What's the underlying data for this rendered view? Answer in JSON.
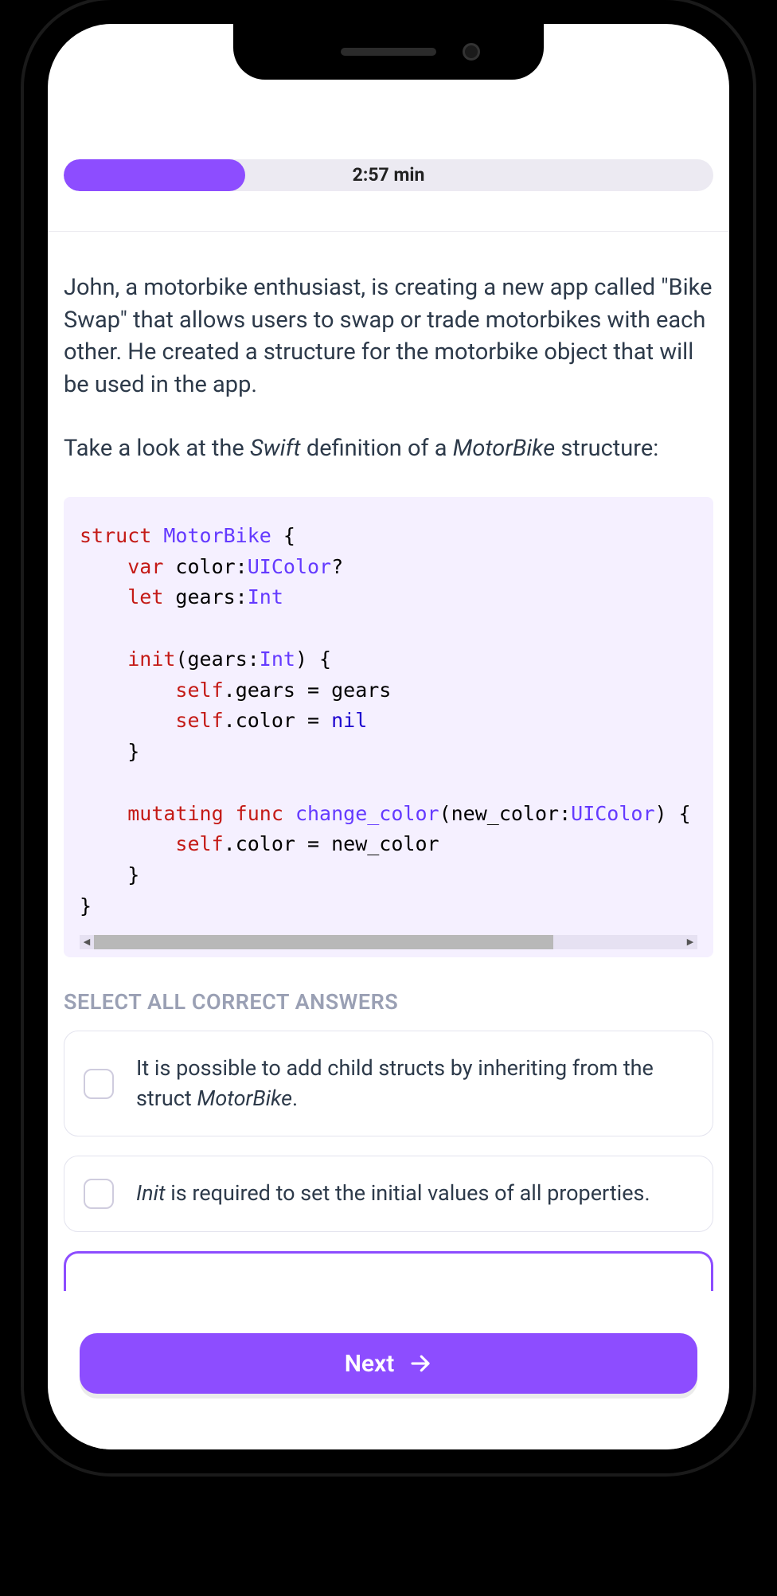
{
  "progress": {
    "percent": 28,
    "time_label": "2:57 min"
  },
  "question": {
    "para1_pre": "John, a motorbike enthusiast, is creating a new app called \"Bike Swap\" that allows users to swap or trade motorbikes with each other. He created a structure for the motorbike object that will be used in the app.",
    "para2_pre": "Take a look at the ",
    "para2_em1": "Swift",
    "para2_mid": " definition of a ",
    "para2_em2": "MotorBike",
    "para2_post": " structure:"
  },
  "code": {
    "lines": [
      [
        {
          "t": "struct ",
          "c": "kw"
        },
        {
          "t": "MotorBike",
          "c": "type"
        },
        {
          "t": " {",
          "c": "plain"
        }
      ],
      [
        {
          "t": "    ",
          "c": "plain"
        },
        {
          "t": "var",
          "c": "kw"
        },
        {
          "t": " color:",
          "c": "plain"
        },
        {
          "t": "UIColor",
          "c": "type"
        },
        {
          "t": "?",
          "c": "plain"
        }
      ],
      [
        {
          "t": "    ",
          "c": "plain"
        },
        {
          "t": "let",
          "c": "kw"
        },
        {
          "t": " gears:",
          "c": "plain"
        },
        {
          "t": "Int",
          "c": "type"
        }
      ],
      [
        {
          "t": "",
          "c": "plain"
        }
      ],
      [
        {
          "t": "    ",
          "c": "plain"
        },
        {
          "t": "init",
          "c": "kw"
        },
        {
          "t": "(gears:",
          "c": "plain"
        },
        {
          "t": "Int",
          "c": "type"
        },
        {
          "t": ") {",
          "c": "plain"
        }
      ],
      [
        {
          "t": "        ",
          "c": "plain"
        },
        {
          "t": "self",
          "c": "kw"
        },
        {
          "t": ".gears = gears",
          "c": "plain"
        }
      ],
      [
        {
          "t": "        ",
          "c": "plain"
        },
        {
          "t": "self",
          "c": "kw"
        },
        {
          "t": ".color = ",
          "c": "plain"
        },
        {
          "t": "nil",
          "c": "int"
        }
      ],
      [
        {
          "t": "    }",
          "c": "plain"
        }
      ],
      [
        {
          "t": "",
          "c": "plain"
        }
      ],
      [
        {
          "t": "    ",
          "c": "plain"
        },
        {
          "t": "mutating func",
          "c": "kw"
        },
        {
          "t": " ",
          "c": "plain"
        },
        {
          "t": "change_color",
          "c": "type"
        },
        {
          "t": "(new_color:",
          "c": "plain"
        },
        {
          "t": "UIColor",
          "c": "type"
        },
        {
          "t": ") {",
          "c": "plain"
        }
      ],
      [
        {
          "t": "        ",
          "c": "plain"
        },
        {
          "t": "self",
          "c": "kw"
        },
        {
          "t": ".color = new_color",
          "c": "plain"
        }
      ],
      [
        {
          "t": "    }",
          "c": "plain"
        }
      ],
      [
        {
          "t": "}",
          "c": "plain"
        }
      ]
    ],
    "scrollbar_thumb_percent": 78
  },
  "answers_header": "SELECT ALL CORRECT ANSWERS",
  "answers": [
    {
      "pre": "It is possible to add child structs by inheriting from the struct ",
      "em": "MotorBike",
      "post": "."
    },
    {
      "em": "Init",
      "pre": "",
      "post": " is required to set the initial values of all properties."
    }
  ],
  "next_label": "Next",
  "colors": {
    "accent": "#8d4dff",
    "text": "#2d3a4a",
    "code_bg": "#f5f0ff"
  }
}
